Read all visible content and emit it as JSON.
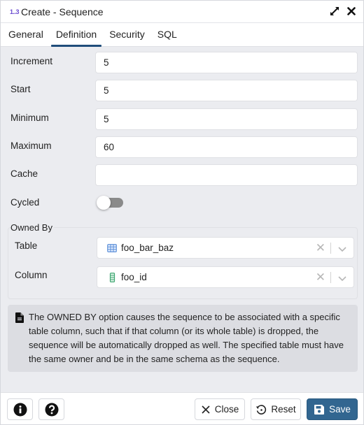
{
  "window": {
    "title_icon": "1..3",
    "title": "Create - Sequence",
    "icons": [
      "expand-icon",
      "close-icon"
    ]
  },
  "tabs": [
    {
      "label": "General",
      "active": false
    },
    {
      "label": "Definition",
      "active": true
    },
    {
      "label": "Security",
      "active": false
    },
    {
      "label": "SQL",
      "active": false
    }
  ],
  "form": {
    "increment": {
      "label": "Increment",
      "value": "5"
    },
    "start": {
      "label": "Start",
      "value": "5"
    },
    "minimum": {
      "label": "Minimum",
      "value": "5"
    },
    "maximum": {
      "label": "Maximum",
      "value": "60"
    },
    "cache": {
      "label": "Cache",
      "value": ""
    },
    "cycled": {
      "label": "Cycled",
      "value": false
    }
  },
  "owned_by": {
    "legend": "Owned By",
    "table": {
      "label": "Table",
      "value": "foo_bar_baz",
      "icon": "table-icon"
    },
    "column": {
      "label": "Column",
      "value": "foo_id",
      "icon": "column-icon"
    }
  },
  "note": {
    "icon": "file-text-icon",
    "text": "The OWNED BY option causes the sequence to be associated with a specific table column, such that if that column (or its whole table) is dropped, the sequence will be automatically dropped as well. The specified table must have the same owner and be in the same schema as the sequence."
  },
  "footer": {
    "info_icon": "info-icon",
    "help_icon": "help-icon",
    "close_label": "Close",
    "reset_label": "Reset",
    "save_label": "Save"
  },
  "colors": {
    "accent": "#326690",
    "tab_underline": "#1f4d7a",
    "table_icon": "#5b8fd8",
    "column_icon": "#3fa672"
  }
}
